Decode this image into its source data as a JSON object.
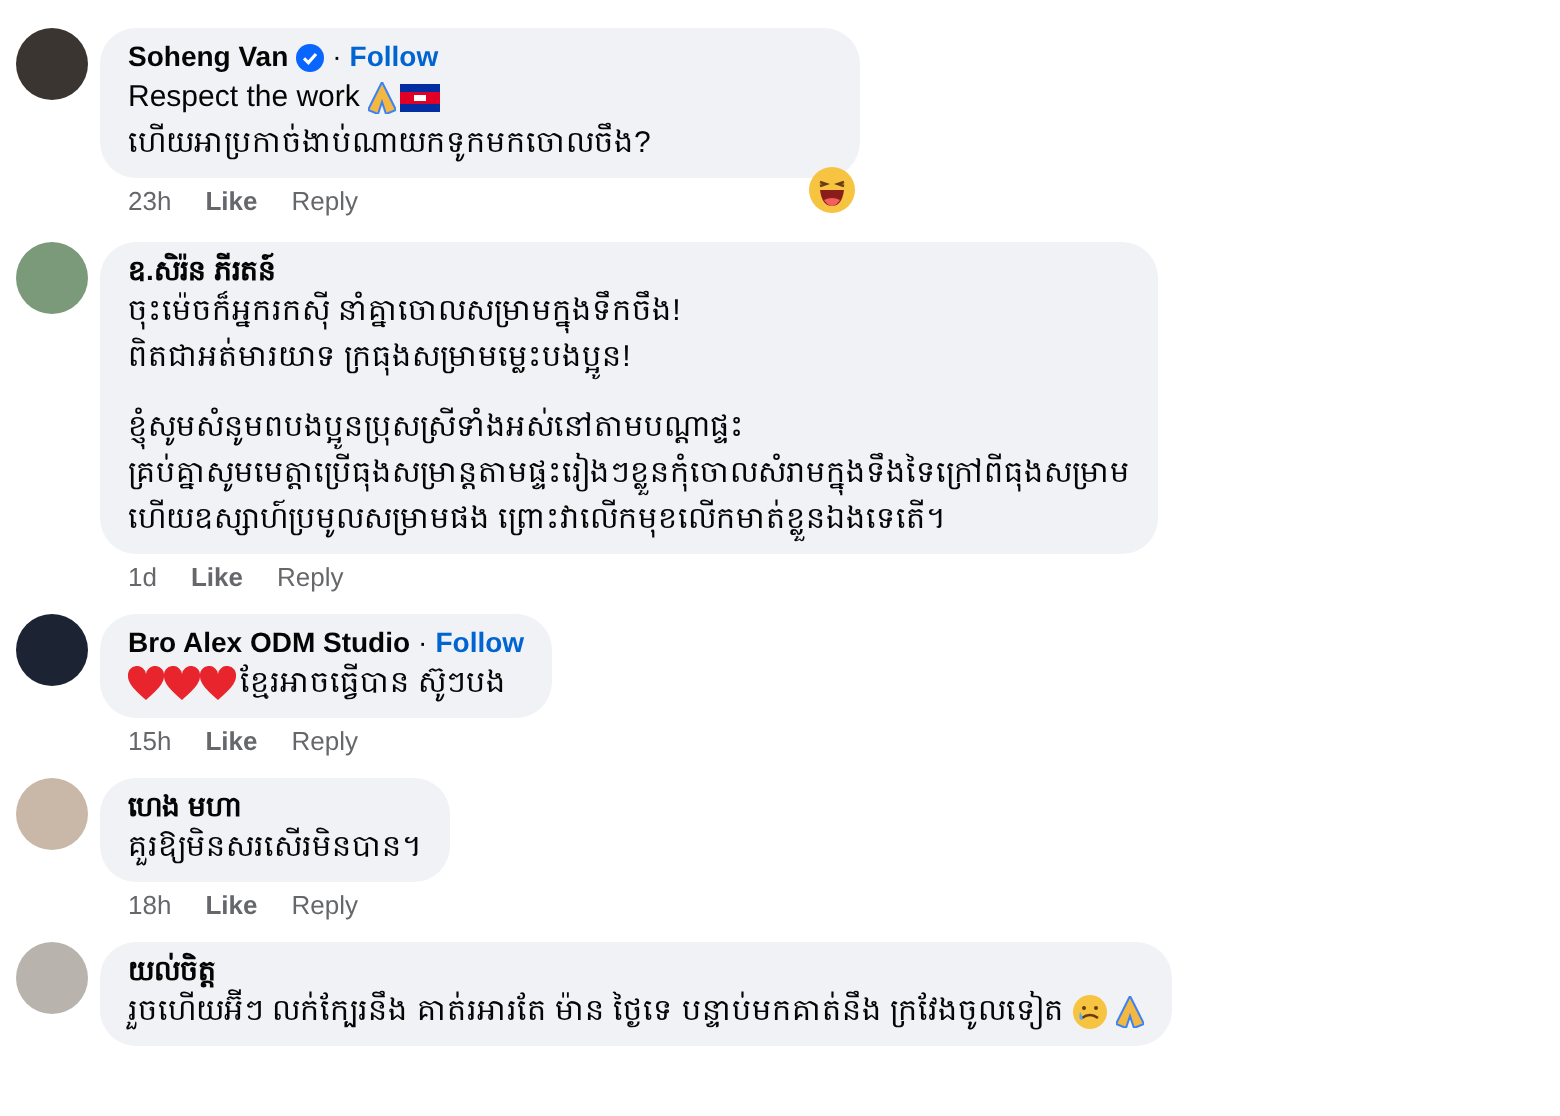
{
  "comments": [
    {
      "author": "Soheng Van",
      "verified": true,
      "separator": "·",
      "follow": "Follow",
      "lines": [
        "Respect the work",
        "ហើយអាប្រកាច់ងាប់ណាយកទូកមកចោលចឹង?"
      ],
      "time": "23h",
      "like": "Like",
      "reply": "Reply"
    },
    {
      "author": "ឧ.សិរ៉ន ភីរតន៍",
      "lines": [
        "ចុះម៉េចក៏អ្នករកស៊ី នាំគ្នាចោលសម្រាមក្នុងទឹកចឹង!",
        "ពិតជាអត់មារយាទ ក្រធុងសម្រាមម្លេះបងប្អូន!"
      ],
      "lines_2": [
        "ខ្ញុំសូមសំនូមពបងប្អូនប្រុសស្រីទាំងអស់នៅតាមបណ្តាផ្ទះ",
        "គ្រប់គ្នាសូមមេត្តាប្រើធុងសម្រាន្តតាមផ្ទះរៀងៗខ្លួនកុំចោលសំរាមក្នុងទឹងទៃក្រៅពីធុងសម្រាម",
        "ហើយឧស្សាហ៍ប្រមូលសម្រាមផង ព្រោះវាលើកមុខលើកមាត់ខ្លួនឯងទេតើ។"
      ],
      "time": "1d",
      "like": "Like",
      "reply": "Reply"
    },
    {
      "author": "Bro Alex ODM Studio",
      "separator": "·",
      "follow": "Follow",
      "lines": [
        "ខ្មែរអាចធ្វើបាន ស៊ូៗបង"
      ],
      "time": "15h",
      "like": "Like",
      "reply": "Reply"
    },
    {
      "author": "ហេង មហា",
      "lines": [
        "គួរឱ្យមិនសរសើរមិនបាន។"
      ],
      "time": "18h",
      "like": "Like",
      "reply": "Reply"
    },
    {
      "author": "យល់ចិត្ត",
      "lines": [
        "រួចហើយអ៊ីៗ លក់ក្បែរនឹង គាត់រអារតែ ម៉ាន ថ្ងៃទេ បន្ទាប់មកគាត់នឹង ក្រវែងចូលទៀត"
      ]
    }
  ]
}
